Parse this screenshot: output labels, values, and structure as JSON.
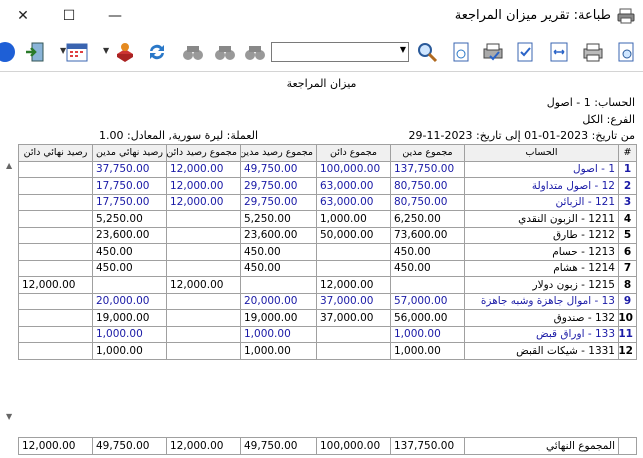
{
  "window": {
    "title": "طباعة: تقرير ميزان المراجعة"
  },
  "report": {
    "title": "ميزان المراجعة",
    "account_line": "الحساب: 1 - اصول",
    "branch_line": "الفرع: الكل",
    "date_line": "من تاريخ: 2023-01-01   إلى تاريخ: 2023-11-29",
    "currency_line": "العملة: ليرة سورية, المعادل: 1.00"
  },
  "columns": [
    "#",
    "الحساب",
    "مجموع مدين",
    "مجموع دائن",
    "مجموع رصيد مدين",
    "مجموع رصيد دائن",
    "رصيد نهائي مدين",
    "رصيد نهائي دائن"
  ],
  "rows": [
    {
      "i": "1",
      "acc": "1 - اصول",
      "d": "137,750.00",
      "c": "100,000.00",
      "bd": "49,750.00",
      "bc": "12,000.00",
      "fd": "37,750.00",
      "fc": "",
      "blue": true
    },
    {
      "i": "2",
      "acc": "12 - اصول متداولة",
      "d": "80,750.00",
      "c": "63,000.00",
      "bd": "29,750.00",
      "bc": "12,000.00",
      "fd": "17,750.00",
      "fc": "",
      "blue": true
    },
    {
      "i": "3",
      "acc": "121 - الزبائن",
      "d": "80,750.00",
      "c": "63,000.00",
      "bd": "29,750.00",
      "bc": "12,000.00",
      "fd": "17,750.00",
      "fc": "",
      "blue": true
    },
    {
      "i": "4",
      "acc": "1211 - الزبون النقدي",
      "d": "6,250.00",
      "c": "1,000.00",
      "bd": "5,250.00",
      "bc": "",
      "fd": "5,250.00",
      "fc": "",
      "blue": false
    },
    {
      "i": "5",
      "acc": "1212 - طارق",
      "d": "73,600.00",
      "c": "50,000.00",
      "bd": "23,600.00",
      "bc": "",
      "fd": "23,600.00",
      "fc": "",
      "blue": false
    },
    {
      "i": "6",
      "acc": "1213 - حسام",
      "d": "450.00",
      "c": "",
      "bd": "450.00",
      "bc": "",
      "fd": "450.00",
      "fc": "",
      "blue": false
    },
    {
      "i": "7",
      "acc": "1214 - هشام",
      "d": "450.00",
      "c": "",
      "bd": "450.00",
      "bc": "",
      "fd": "450.00",
      "fc": "",
      "blue": false
    },
    {
      "i": "8",
      "acc": "1215 - زبون دولار",
      "d": "",
      "c": "12,000.00",
      "bd": "",
      "bc": "12,000.00",
      "fd": "",
      "fc": "12,000.00",
      "blue": false
    },
    {
      "i": "9",
      "acc": "13 - اموال جاهزة وشبه جاهزة",
      "d": "57,000.00",
      "c": "37,000.00",
      "bd": "20,000.00",
      "bc": "",
      "fd": "20,000.00",
      "fc": "",
      "blue": true
    },
    {
      "i": "10",
      "acc": "132 - صندوق",
      "d": "56,000.00",
      "c": "37,000.00",
      "bd": "19,000.00",
      "bc": "",
      "fd": "19,000.00",
      "fc": "",
      "blue": false
    },
    {
      "i": "11",
      "acc": "133 - اوراق قبض",
      "d": "1,000.00",
      "c": "",
      "bd": "1,000.00",
      "bc": "",
      "fd": "1,000.00",
      "fc": "",
      "blue": true
    },
    {
      "i": "12",
      "acc": "1331 - شيكات القبض",
      "d": "1,000.00",
      "c": "",
      "bd": "1,000.00",
      "bc": "",
      "fd": "1,000.00",
      "fc": "",
      "blue": false
    }
  ],
  "totals": {
    "label": "المجموع النهائي",
    "d": "137,750.00",
    "c": "100,000.00",
    "bd": "49,750.00",
    "bc": "12,000.00",
    "fd": "49,750.00",
    "fc": "12,000.00"
  },
  "icons": [
    "print-icon",
    "minimize-icon",
    "maximize-icon",
    "close-icon",
    "exit-icon",
    "calendar-icon",
    "refresh-icon",
    "binoculars-icon",
    "search-icon",
    "export-icon",
    "printer-icon",
    "page-setup-icon"
  ],
  "colors": {
    "accent_blue": "#1a1aa6",
    "header_bg": "#f0f0f0",
    "grid_line": "#a0a0a0"
  }
}
